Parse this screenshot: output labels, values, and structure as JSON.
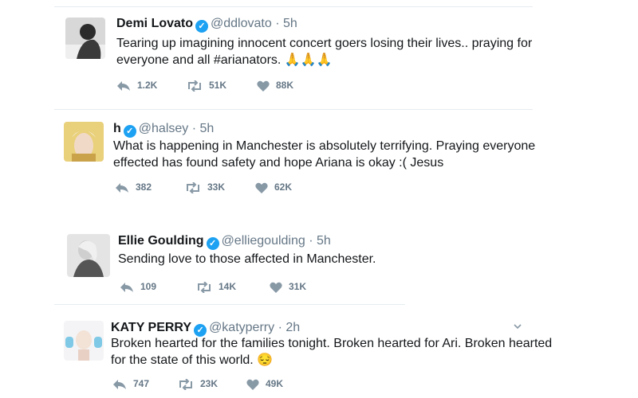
{
  "tweets": [
    {
      "name": "Demi Lovato",
      "handle": "@ddlovato",
      "time": "5h",
      "text_line1": "Tearing up imagining innocent concert goers losing their lives.. praying for",
      "text_line2": "everyone and all #arianators. 🙏🙏🙏",
      "replies": "1.2K",
      "retweets": "51K",
      "likes": "88K"
    },
    {
      "name": "h",
      "handle": "@halsey",
      "time": "5h",
      "text_line1": "What is happening in Manchester is absolutely terrifying. Praying everyone",
      "text_line2": "effected has found safety and hope Ariana is okay :( Jesus",
      "replies": "382",
      "retweets": "33K",
      "likes": "62K"
    },
    {
      "name": "Ellie Goulding",
      "handle": "@elliegoulding",
      "time": "5h",
      "text_line1": "Sending love to those affected in Manchester.",
      "replies": "109",
      "retweets": "14K",
      "likes": "31K"
    },
    {
      "name": "KATY PERRY",
      "handle": "@katyperry",
      "time": "2h",
      "text_line1": "Broken hearted for the families tonight. Broken hearted for Ari. Broken hearted",
      "text_line2": "for the state of this world. 😔",
      "replies": "747",
      "retweets": "23K",
      "likes": "49K"
    }
  ],
  "separator": "·",
  "colors": {
    "verified": "#1da1f2",
    "meta": "#657786",
    "text": "#14171a",
    "divider": "#e6ecf0"
  },
  "icons": {
    "reply": "reply-icon",
    "retweet": "retweet-icon",
    "like": "heart-icon",
    "verified": "verified-badge-icon",
    "more": "chevron-down-icon"
  }
}
